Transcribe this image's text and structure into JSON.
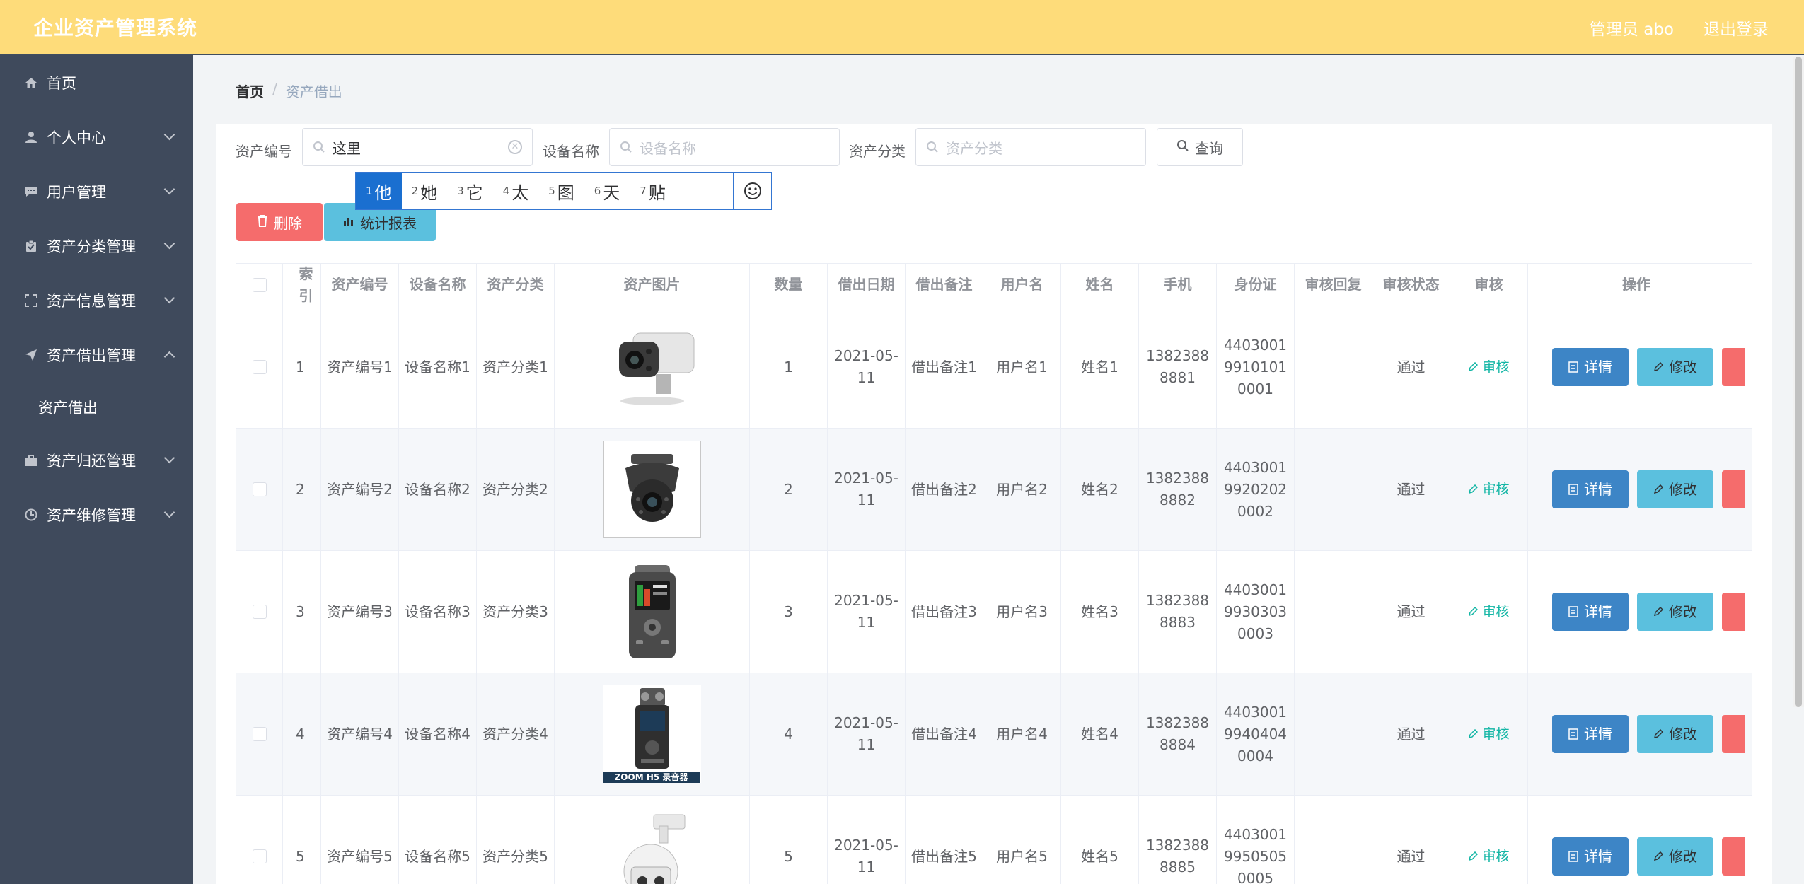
{
  "header": {
    "title": "企业资产管理系统",
    "user_label": "管理员 abo",
    "logout_label": "退出登录"
  },
  "sidebar": {
    "items": [
      {
        "label": "首页",
        "icon": "home-icon"
      },
      {
        "label": "个人中心",
        "icon": "user-icon"
      },
      {
        "label": "用户管理",
        "icon": "chat-icon"
      },
      {
        "label": "资产分类管理",
        "icon": "clipboard-icon"
      },
      {
        "label": "资产信息管理",
        "icon": "scan-icon"
      },
      {
        "label": "资产借出管理",
        "icon": "send-icon",
        "expanded": true
      },
      {
        "label": "资产借出",
        "sub": true
      },
      {
        "label": "资产归还管理",
        "icon": "briefcase-icon"
      },
      {
        "label": "资产维修管理",
        "icon": "clock-icon"
      }
    ]
  },
  "breadcrumb": {
    "home": "首页",
    "sep": "/",
    "current": "资产借出"
  },
  "search": {
    "asset_no_label": "资产编号",
    "asset_no_value": "这里",
    "device_name_label": "设备名称",
    "device_name_placeholder": "设备名称",
    "category_label": "资产分类",
    "category_placeholder": "资产分类",
    "query_label": "查询"
  },
  "ime": {
    "candidates": [
      {
        "num": "1",
        "char": "他"
      },
      {
        "num": "2",
        "char": "她"
      },
      {
        "num": "3",
        "char": "它"
      },
      {
        "num": "4",
        "char": "太"
      },
      {
        "num": "5",
        "char": "图"
      },
      {
        "num": "6",
        "char": "天"
      },
      {
        "num": "7",
        "char": "贴"
      }
    ]
  },
  "actions": {
    "delete_label": "删除",
    "stats_label": "统计报表"
  },
  "table": {
    "headers": [
      "索引",
      "资产编号",
      "设备名称",
      "资产分类",
      "资产图片",
      "数量",
      "借出日期",
      "借出备注",
      "用户名",
      "姓名",
      "手机",
      "身份证",
      "审核回复",
      "审核状态",
      "审核",
      "操作"
    ],
    "audit_label": "审核",
    "detail_label": "详情",
    "edit_label": "修改",
    "rows": [
      {
        "index": "1",
        "asset_no": "资产编号1",
        "device": "设备名称1",
        "category": "资产分类1",
        "qty": "1",
        "date": "2021-05-11",
        "note": "借出备注1",
        "username": "用户名1",
        "name": "姓名1",
        "phone": "13823888881",
        "id_card": "440300199101010001",
        "reply": "",
        "status": "通过"
      },
      {
        "index": "2",
        "asset_no": "资产编号2",
        "device": "设备名称2",
        "category": "资产分类2",
        "qty": "2",
        "date": "2021-05-11",
        "note": "借出备注2",
        "username": "用户名2",
        "name": "姓名2",
        "phone": "13823888882",
        "id_card": "440300199202020002",
        "reply": "",
        "status": "通过"
      },
      {
        "index": "3",
        "asset_no": "资产编号3",
        "device": "设备名称3",
        "category": "资产分类3",
        "qty": "3",
        "date": "2021-05-11",
        "note": "借出备注3",
        "username": "用户名3",
        "name": "姓名3",
        "phone": "13823888883",
        "id_card": "440300199303030003",
        "reply": "",
        "status": "通过"
      },
      {
        "index": "4",
        "asset_no": "资产编号4",
        "device": "设备名称4",
        "category": "资产分类4",
        "qty": "4",
        "date": "2021-05-11",
        "note": "借出备注4",
        "username": "用户名4",
        "name": "姓名4",
        "phone": "13823888884",
        "id_card": "440300199404040004",
        "reply": "",
        "status": "通过"
      },
      {
        "index": "5",
        "asset_no": "资产编号5",
        "device": "设备名称5",
        "category": "资产分类5",
        "qty": "5",
        "date": "2021-05-11",
        "note": "借出备注5",
        "username": "用户名5",
        "name": "姓名5",
        "phone": "13823888885",
        "id_card": "440300199505050005",
        "reply": "",
        "status": "通过"
      }
    ],
    "image_caption_row4": "ZOOM H5 录音器"
  }
}
